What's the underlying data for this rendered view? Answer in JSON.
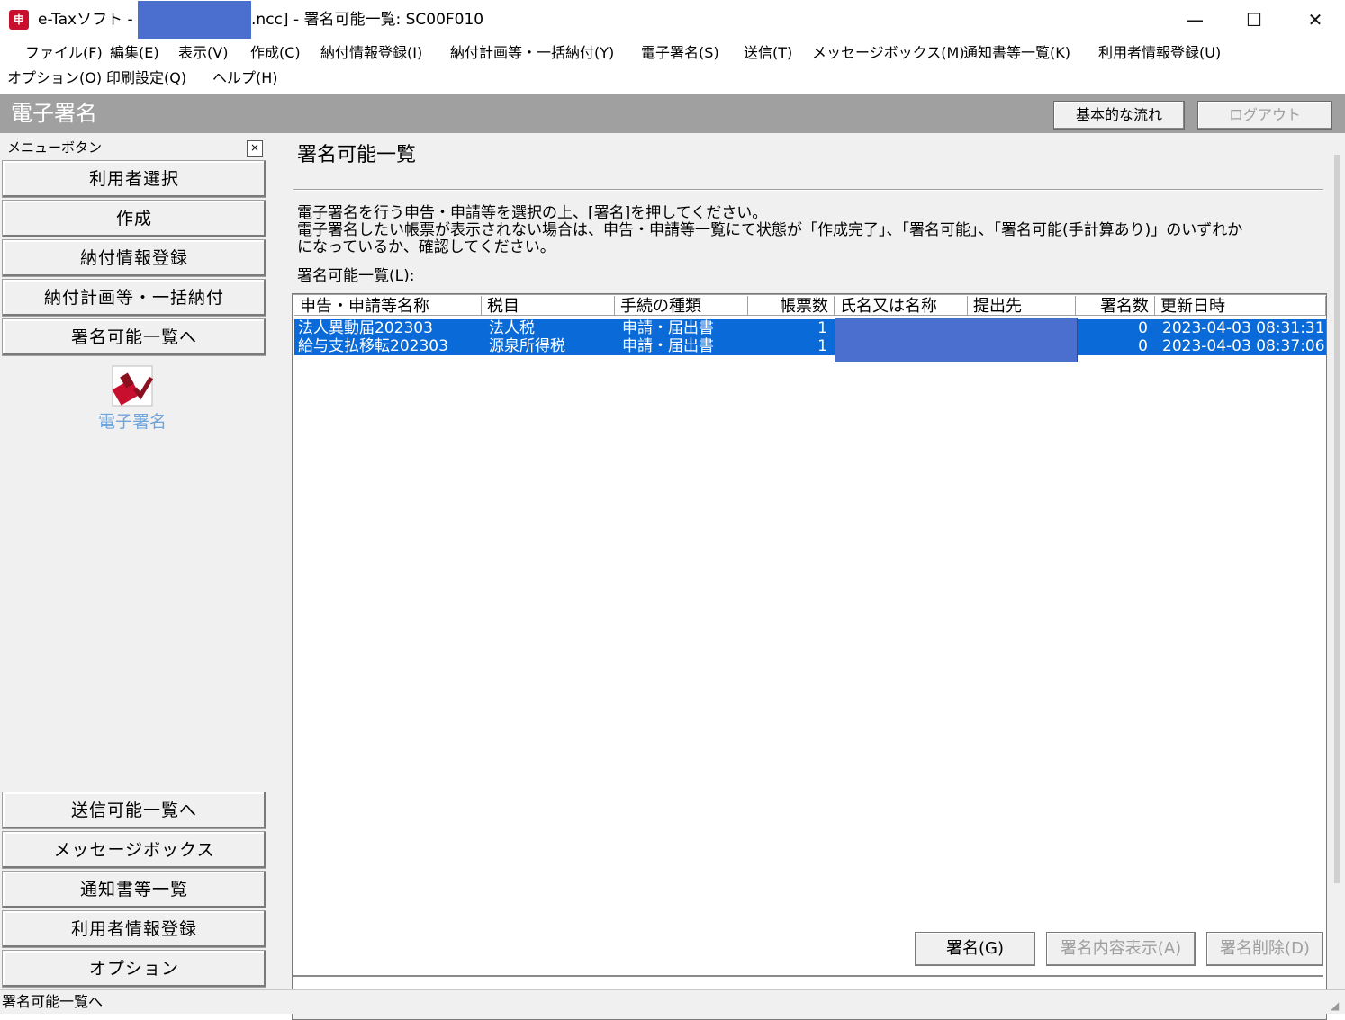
{
  "window": {
    "title_prefix": "e-Taxソフト -",
    "title_suffix": ".ncc] - 署名可能一覧: SC00F010",
    "minimize": "—",
    "maximize": "☐",
    "close": "✕"
  },
  "menu": {
    "items": [
      "ファイル(F)",
      "編集(E)",
      "表示(V)",
      "作成(C)",
      "納付情報登録(I)",
      "納付計画等・一括納付(Y)",
      "電子署名(S)",
      "送信(T)",
      "メッセージボックス(M)",
      "通知書等一覧(K)",
      "利用者情報登録(U)",
      "オプション(O)",
      "印刷設定(Q)",
      "ヘルプ(H)"
    ]
  },
  "header": {
    "title": "電子署名",
    "flow_button": "基本的な流れ",
    "logout_button": "ログアウト"
  },
  "sidebar": {
    "header": "メニューボタン",
    "close": "×",
    "top_buttons": [
      "利用者選択",
      "作成",
      "納付情報登録",
      "納付計画等・一括納付",
      "署名可能一覧へ"
    ],
    "stamp_label": "電子署名",
    "bottom_buttons": [
      "送信可能一覧へ",
      "メッセージボックス",
      "通知書等一覧",
      "利用者情報登録",
      "オプション"
    ]
  },
  "main": {
    "title": "署名可能一覧",
    "instructions": [
      "電子署名を行う申告・申請等を選択の上、[署名]を押してください。",
      "電子署名したい帳票が表示されない場合は、申告・申請等一覧にて状態が「作成完了」、「署名可能」、「署名可能(手計算あり)」のいずれか",
      "になっているか、確認してください。"
    ],
    "list_label": "署名可能一覧(L):",
    "columns": [
      "申告・申請等名称",
      "税目",
      "手続の種類",
      "帳票数",
      "氏名又は名称",
      "提出先",
      "署名数",
      "更新日時"
    ],
    "rows": [
      [
        "法人異動届202303",
        "法人税",
        "申請・届出書",
        "1",
        "",
        "",
        "0",
        "2023-04-03 08:31:31"
      ],
      [
        "給与支払移転202303",
        "源泉所得税",
        "申請・届出書",
        "1",
        "",
        "",
        "0",
        "2023-04-03 08:37:06"
      ]
    ],
    "buttons": {
      "sign": "署名(G)",
      "show": "署名内容表示(A)",
      "delete": "署名削除(D)"
    }
  },
  "status": {
    "text": "署名可能一覧へ"
  },
  "colors": {
    "selection": "#0a6ad8",
    "header_bar": "#a0a0a0",
    "redaction": "#4a6fcf",
    "stamp_label": "#6fa5dc"
  }
}
